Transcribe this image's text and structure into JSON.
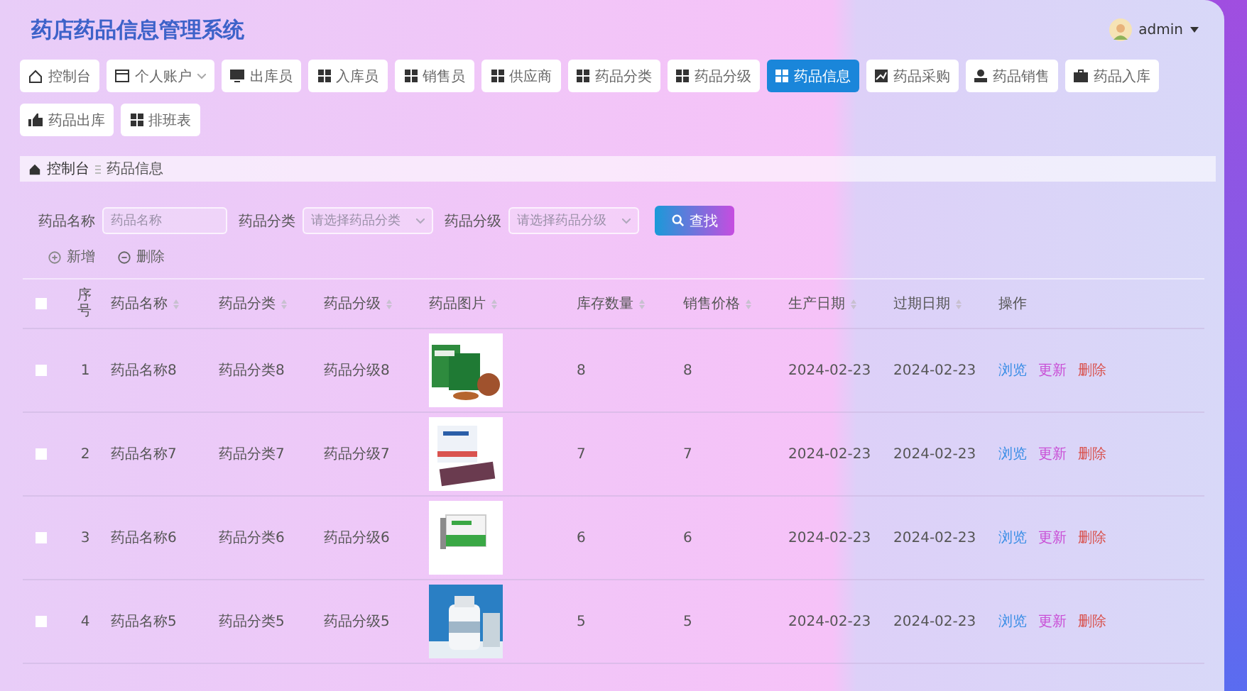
{
  "title": "药店药品信息管理系统",
  "user": {
    "name": "admin"
  },
  "nav": [
    {
      "label": "控制台",
      "kind": "home",
      "selected": false
    },
    {
      "label": "个人账户",
      "kind": "card",
      "selected": false,
      "dropdown": true
    },
    {
      "label": "出库员",
      "kind": "monitor",
      "selected": false
    },
    {
      "label": "入库员",
      "kind": "grid",
      "selected": false
    },
    {
      "label": "销售员",
      "kind": "grid",
      "selected": false
    },
    {
      "label": "供应商",
      "kind": "grid",
      "selected": false
    },
    {
      "label": "药品分类",
      "kind": "grid",
      "selected": false
    },
    {
      "label": "药品分级",
      "kind": "grid",
      "selected": false
    },
    {
      "label": "药品信息",
      "kind": "grid",
      "selected": true
    },
    {
      "label": "药品采购",
      "kind": "chart",
      "selected": false
    },
    {
      "label": "药品销售",
      "kind": "person",
      "selected": false
    },
    {
      "label": "药品入库",
      "kind": "bag",
      "selected": false
    },
    {
      "label": "药品出库",
      "kind": "thumb",
      "selected": false
    },
    {
      "label": "排班表",
      "kind": "grid",
      "selected": false
    }
  ],
  "breadcrumb": [
    "控制台",
    "药品信息"
  ],
  "filters": [
    {
      "label": "药品名称",
      "kind": "input",
      "placeholder": "药品名称"
    },
    {
      "label": "药品分类",
      "kind": "select",
      "placeholder": "请选择药品分类"
    },
    {
      "label": "药品分级",
      "kind": "select",
      "placeholder": "请选择药品分级"
    }
  ],
  "search_button": "查找",
  "actions": [
    {
      "label": "新增",
      "kind": "add"
    },
    {
      "label": "删除",
      "kind": "remove"
    }
  ],
  "table": {
    "all_checked": false,
    "columns": [
      "序号",
      "药品名称",
      "药品分类",
      "药品分级",
      "药品图片",
      "库存数量",
      "销售价格",
      "生产日期",
      "过期日期",
      "操作"
    ],
    "rows": [
      {
        "checked": false,
        "cells": [
          "1",
          "药品名称8",
          "药品分类8",
          "药品分级8",
          "",
          "8",
          "8",
          "2024-02-23",
          "2024-02-23"
        ],
        "actions": [
          {
            "label": "浏览",
            "kind": "view"
          },
          {
            "label": "更新",
            "kind": "edit"
          },
          {
            "label": "删除",
            "kind": "delete"
          }
        ]
      },
      {
        "checked": false,
        "cells": [
          "2",
          "药品名称7",
          "药品分类7",
          "药品分级7",
          "",
          "7",
          "7",
          "2024-02-23",
          "2024-02-23"
        ],
        "actions": [
          {
            "label": "浏览",
            "kind": "view"
          },
          {
            "label": "更新",
            "kind": "edit"
          },
          {
            "label": "删除",
            "kind": "delete"
          }
        ]
      },
      {
        "checked": false,
        "cells": [
          "3",
          "药品名称6",
          "药品分类6",
          "药品分级6",
          "",
          "6",
          "6",
          "2024-02-23",
          "2024-02-23"
        ],
        "actions": [
          {
            "label": "浏览",
            "kind": "view"
          },
          {
            "label": "更新",
            "kind": "edit"
          },
          {
            "label": "删除",
            "kind": "delete"
          }
        ]
      },
      {
        "checked": false,
        "cells": [
          "4",
          "药品名称5",
          "药品分类5",
          "药品分级5",
          "",
          "5",
          "5",
          "2024-02-23",
          "2024-02-23"
        ],
        "actions": [
          {
            "label": "浏览",
            "kind": "view"
          },
          {
            "label": "更新",
            "kind": "edit"
          },
          {
            "label": "删除",
            "kind": "delete"
          }
        ]
      }
    ]
  }
}
